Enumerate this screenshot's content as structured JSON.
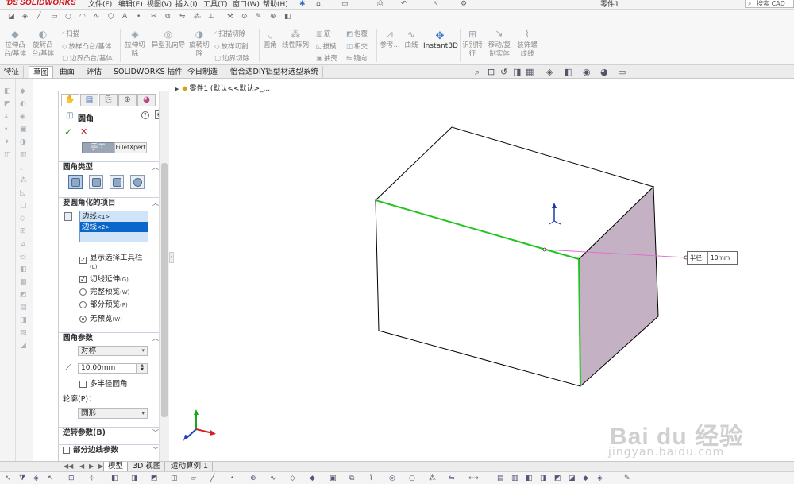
{
  "app": {
    "logo_text": "SOLIDWORKS",
    "document_title": "零件1",
    "search_placeholder": "搜索 CAD"
  },
  "menu": {
    "items": [
      "文件(F)",
      "编辑(E)",
      "视图(V)",
      "插入(I)",
      "工具(T)",
      "窗口(W)",
      "帮助(H)"
    ]
  },
  "command_manager": {
    "features_group1": {
      "extrude_boss": "拉伸凸\n台/基体",
      "revolve_boss": "旋转凸\n台/基体",
      "sweep": "扫描",
      "loft_boss": "放样凸台/基体",
      "boundary_boss": "边界凸台/基体"
    },
    "features_group2": {
      "extrude_cut": "拉伸切\n除",
      "hole_wizard": "异型孔向导",
      "revolve_cut": "旋转切\n除",
      "swept_cut": "扫描切除",
      "lofted_cut": "放样切割",
      "boundary_cut": "边界切除"
    },
    "features_group3": {
      "fillet": "圆角",
      "linear_pattern": "线性阵列",
      "rib": "筋",
      "wrap": "包覆",
      "draft": "拔模",
      "intersect": "相交",
      "shell": "抽壳",
      "mirror": "镜向"
    },
    "features_group4": {
      "reference": "参考...",
      "curves": "曲线",
      "instant3d": "Instant3D"
    },
    "features_group5": {
      "recognize": "识别特\n征",
      "move_copy": "移动/复\n制实体",
      "decorative_thread": "装饰螺\n纹线"
    }
  },
  "tabs": [
    {
      "label": "特征",
      "active": false
    },
    {
      "label": "草图",
      "active": true
    },
    {
      "label": "曲面",
      "active": false
    },
    {
      "label": "评估",
      "active": false
    },
    {
      "label": "SOLIDWORKS 插件",
      "active": false
    },
    {
      "label": "今日制造",
      "active": false
    },
    {
      "label": "怡合达DIY铝型材选型系统",
      "active": false
    }
  ],
  "property_manager": {
    "title": "圆角",
    "manual_label": "手工",
    "filletxpert_label": "FilletXpert",
    "fillet_type_header": "圆角类型",
    "items_header": "要圆角化的项目",
    "items": [
      {
        "label": "边线",
        "sub": "<1>",
        "selected": false
      },
      {
        "label": "边线",
        "sub": "<2>",
        "selected": true
      }
    ],
    "show_selection_toolbar": {
      "label": "显示选择工具栏",
      "sub": "(L)",
      "checked": true
    },
    "tangent_propagation": {
      "label": "切线延伸",
      "sub": "(G)",
      "checked": true
    },
    "preview_options": [
      {
        "label": "完整预览",
        "sub": "(W)",
        "selected": false
      },
      {
        "label": "部分预览",
        "sub": "(P)",
        "selected": false
      },
      {
        "label": "无预览",
        "sub": "(W)",
        "selected": true
      }
    ],
    "params_header": "圆角参数",
    "method_value": "对称",
    "radius_value": "10.00mm",
    "multi_radius": {
      "label": "多半径圆角",
      "checked": false
    },
    "profile_label": "轮廓(P)：",
    "profile_value": "圆形",
    "setback_header": "逆转参数(B)",
    "partial_edge_header": "部分边线参数"
  },
  "feature_tree": {
    "label": "零件1 (默认<<默认>_..."
  },
  "viewport": {
    "dimension_key": "半径:",
    "dimension_value": "10mm",
    "highlight_color": "#1fc41f",
    "side_face_color": "#c4b1c4",
    "watermark_text": "Bai du 经验",
    "watermark_url": "jingyan.baidu.com"
  },
  "bottom_tabs": [
    {
      "label": "模型",
      "active": true
    },
    {
      "label": "3D 视图",
      "active": false
    },
    {
      "label": "运动算例 1",
      "active": false
    }
  ]
}
